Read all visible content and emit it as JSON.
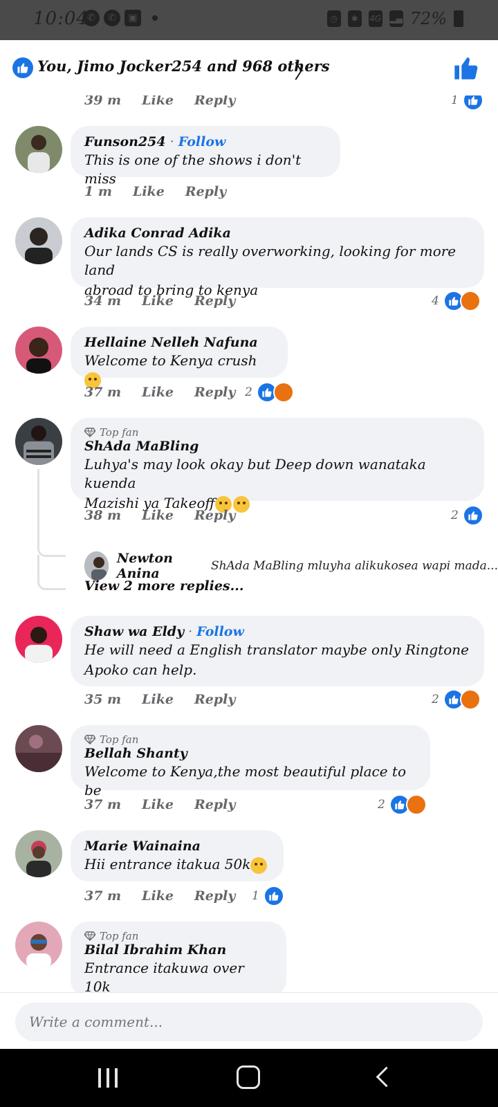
{
  "status": {
    "time": "10:04",
    "battery": "72%"
  },
  "header": {
    "reactions_text": "You, Jimo Jocker254 and 968 others"
  },
  "top_meta": {
    "time": "39 m",
    "like": "Like",
    "reply": "Reply",
    "count": "1"
  },
  "comments": [
    {
      "author": "Funson254",
      "follow": "Follow",
      "text": "This is one of the shows i don't miss",
      "time": "1 m",
      "like": "Like",
      "reply": "Reply"
    },
    {
      "author": "Adika Conrad Adika",
      "text_line1": "Our lands CS is really overworking, looking for more land",
      "text_line2": "abroad to bring to kenya",
      "time": "34 m",
      "like": "Like",
      "reply": "Reply",
      "react_count": "4"
    },
    {
      "author": "Hellaine Nelleh Nafuna",
      "text": "Welcome to Kenya crush",
      "time": "37 m",
      "like": "Like",
      "reply": "Reply",
      "react_count": "2"
    },
    {
      "badge": "Top fan",
      "author": "ShAda MaBling",
      "text_line1": "Luhya's may look okay but Deep down wanataka kuenda",
      "text_line2": "Mazishi ya Takeoff",
      "time": "38 m",
      "like": "Like",
      "reply": "Reply",
      "react_count": "2",
      "reply_preview": {
        "author": "Newton Anina",
        "snippet": "ShAda MaBling mluyha alikukosea wapi mada..."
      },
      "view_more": "View 2 more replies..."
    },
    {
      "author": "Shaw wa Eldy",
      "follow": "Follow",
      "text_line1": "He will need a English translator maybe only Ringtone",
      "text_line2": "Apoko can help.",
      "time": "35 m",
      "like": "Like",
      "reply": "Reply",
      "react_count": "2"
    },
    {
      "badge": "Top fan",
      "author": "Bellah Shanty",
      "text": "Welcome to Kenya,the most beautiful place to be",
      "time": "37 m",
      "like": "Like",
      "reply": "Reply",
      "react_count": "2"
    },
    {
      "author": "Marie Wainaina",
      "text": "Hii entrance itakua 50k",
      "time": "37 m",
      "like": "Like",
      "reply": "Reply",
      "react_count": "1"
    },
    {
      "badge": "Top fan",
      "author": "Bilal Ibrahim Khan",
      "text": "Entrance itakuwa over 10k"
    }
  ],
  "composer": {
    "placeholder": "Write a comment..."
  },
  "colors": {
    "accent": "#1b74e4",
    "bubble": "#f0f2f5",
    "angry": "#e9710f"
  }
}
